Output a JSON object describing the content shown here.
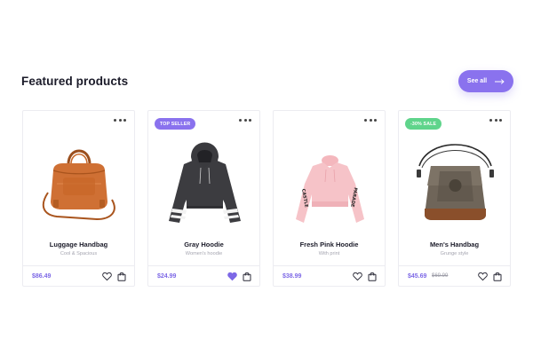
{
  "section": {
    "title": "Featured products",
    "see_all_label": "See all",
    "see_all_icon": "arrow-right-icon"
  },
  "colors": {
    "accent": "#8a72ee",
    "price": "#7d68e6",
    "sale_badge": "#5fd48b",
    "top_seller_badge": "#8a72ee",
    "favorite": "#7d68e6"
  },
  "products": [
    {
      "name": "Luggage Handbag",
      "subtitle": "Cool & Spacious",
      "price": "$86.49",
      "old_price": "",
      "badge": "",
      "favorited": false,
      "image": "luggage-handbag"
    },
    {
      "name": "Gray Hoodie",
      "subtitle": "Women's hoodie",
      "price": "$24.99",
      "old_price": "",
      "badge": "TOP SELLER",
      "favorited": true,
      "image": "gray-hoodie"
    },
    {
      "name": "Fresh Pink Hoodie",
      "subtitle": "With print",
      "price": "$38.99",
      "old_price": "",
      "badge": "",
      "favorited": false,
      "image": "pink-hoodie"
    },
    {
      "name": "Men's Handbag",
      "subtitle": "Grunge style",
      "price": "$45.69",
      "old_price": "$69.99",
      "badge": "-30% SALE",
      "favorited": false,
      "image": "mens-handbag"
    }
  ],
  "icons": {
    "more": "more-horizontal-icon",
    "favorite": "heart-icon",
    "cart": "shopping-bag-icon"
  }
}
